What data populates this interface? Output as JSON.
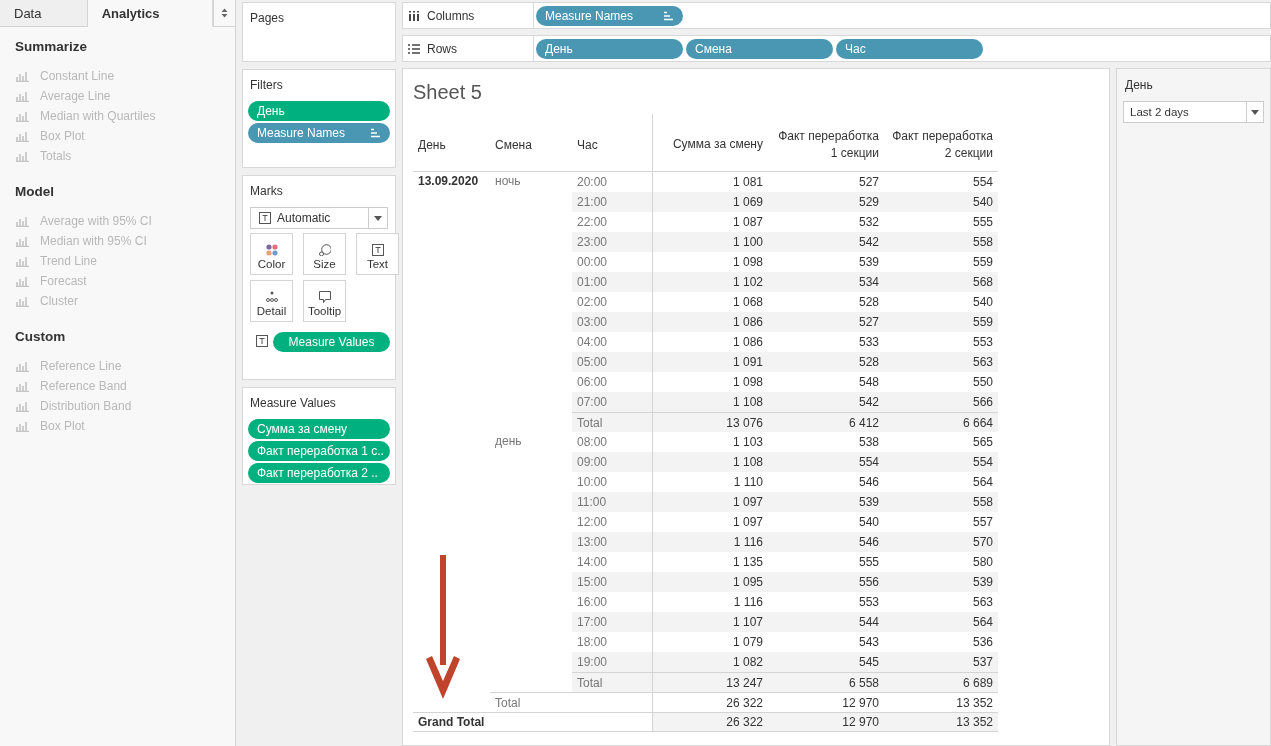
{
  "side_tabs": [
    {
      "label": "Data",
      "selected": false
    },
    {
      "label": "Analytics",
      "selected": true
    }
  ],
  "analytics": [
    {
      "title": "Summarize",
      "items": [
        {
          "label": "Constant Line",
          "disabled": true
        },
        {
          "label": "Average Line",
          "disabled": true
        },
        {
          "label": "Median with Quartiles",
          "disabled": true
        },
        {
          "label": "Box Plot",
          "disabled": true
        },
        {
          "label": "Totals",
          "disabled": true
        }
      ]
    },
    {
      "title": "Model",
      "items": [
        {
          "label": "Average with 95% CI",
          "disabled": true
        },
        {
          "label": "Median with 95% CI",
          "disabled": true
        },
        {
          "label": "Trend Line",
          "disabled": true
        },
        {
          "label": "Forecast",
          "disabled": true
        },
        {
          "label": "Cluster",
          "disabled": true
        }
      ]
    },
    {
      "title": "Custom",
      "items": [
        {
          "label": "Reference Line",
          "disabled": true
        },
        {
          "label": "Reference Band",
          "disabled": true
        },
        {
          "label": "Distribution Band",
          "disabled": true
        },
        {
          "label": "Box Plot",
          "disabled": true
        }
      ]
    }
  ],
  "pages": {
    "title": "Pages"
  },
  "filters": {
    "title": "Filters",
    "pills": [
      {
        "label": "День",
        "kind": "measure",
        "sorted": false
      },
      {
        "label": "Measure Names",
        "kind": "dimension",
        "sorted": true
      }
    ]
  },
  "marks": {
    "title": "Marks",
    "mark_type": "Automatic",
    "buttons": [
      {
        "label": "Color",
        "kind": "color"
      },
      {
        "label": "Size",
        "kind": "size"
      },
      {
        "label": "Text",
        "kind": "text"
      },
      {
        "label": "Detail",
        "kind": "detail"
      },
      {
        "label": "Tooltip",
        "kind": "tooltip"
      }
    ],
    "pills": [
      {
        "label": "Measure Values",
        "kind": "measure",
        "sorted": false
      }
    ]
  },
  "measure_values": {
    "title": "Measure Values",
    "pills": [
      {
        "label": "Сумма за смену",
        "kind": "measure",
        "sorted": false
      },
      {
        "label": "Факт переработка 1 с..",
        "kind": "measure",
        "sorted": false
      },
      {
        "label": "Факт переработка 2 ..",
        "kind": "measure",
        "sorted": false
      }
    ]
  },
  "columns_shelf": {
    "label": "Columns",
    "pills": [
      {
        "label": "Measure Names",
        "kind": "dimension",
        "sorted": true
      }
    ]
  },
  "rows_shelf": {
    "label": "Rows",
    "pills": [
      {
        "label": "День",
        "kind": "dimension",
        "sorted": false
      },
      {
        "label": "Смена",
        "kind": "dimension",
        "sorted": false
      },
      {
        "label": "Час",
        "kind": "dimension",
        "sorted": false
      }
    ]
  },
  "sheet": {
    "title": "Sheet 5",
    "columns": [
      "День",
      "Смена",
      "Час",
      "Сумма за смену",
      "Факт переработка\n1 секции",
      "Факт переработка\n2 секции"
    ],
    "days": [
      {
        "label": "13.09.2020",
        "shifts": [
          {
            "label": "ночь",
            "rows": [
              [
                "20:00",
                "1 081",
                "527",
                "554"
              ],
              [
                "21:00",
                "1 069",
                "529",
                "540"
              ],
              [
                "22:00",
                "1 087",
                "532",
                "555"
              ],
              [
                "23:00",
                "1 100",
                "542",
                "558"
              ],
              [
                "00:00",
                "1 098",
                "539",
                "559"
              ],
              [
                "01:00",
                "1 102",
                "534",
                "568"
              ],
              [
                "02:00",
                "1 068",
                "528",
                "540"
              ],
              [
                "03:00",
                "1 086",
                "527",
                "559"
              ],
              [
                "04:00",
                "1 086",
                "533",
                "553"
              ],
              [
                "05:00",
                "1 091",
                "528",
                "563"
              ],
              [
                "06:00",
                "1 098",
                "548",
                "550"
              ],
              [
                "07:00",
                "1 108",
                "542",
                "566"
              ]
            ],
            "total": [
              "Total",
              "13 076",
              "6 412",
              "6 664"
            ]
          },
          {
            "label": "день",
            "rows": [
              [
                "08:00",
                "1 103",
                "538",
                "565"
              ],
              [
                "09:00",
                "1 108",
                "554",
                "554"
              ],
              [
                "10:00",
                "1 110",
                "546",
                "564"
              ],
              [
                "11:00",
                "1 097",
                "539",
                "558"
              ],
              [
                "12:00",
                "1 097",
                "540",
                "557"
              ],
              [
                "13:00",
                "1 116",
                "546",
                "570"
              ],
              [
                "14:00",
                "1 135",
                "555",
                "580"
              ],
              [
                "15:00",
                "1 095",
                "556",
                "539"
              ],
              [
                "16:00",
                "1 116",
                "553",
                "563"
              ],
              [
                "17:00",
                "1 107",
                "544",
                "564"
              ],
              [
                "18:00",
                "1 079",
                "543",
                "536"
              ],
              [
                "19:00",
                "1 082",
                "545",
                "537"
              ]
            ],
            "total": [
              "Total",
              "13 247",
              "6 558",
              "6 689"
            ]
          }
        ],
        "total": [
          "Total",
          "26 322",
          "12 970",
          "13 352"
        ]
      }
    ],
    "grand_total": [
      "Grand Total",
      "26 322",
      "12 970",
      "13 352"
    ]
  },
  "filter_card": {
    "title": "День",
    "value": "Last 2 days"
  }
}
